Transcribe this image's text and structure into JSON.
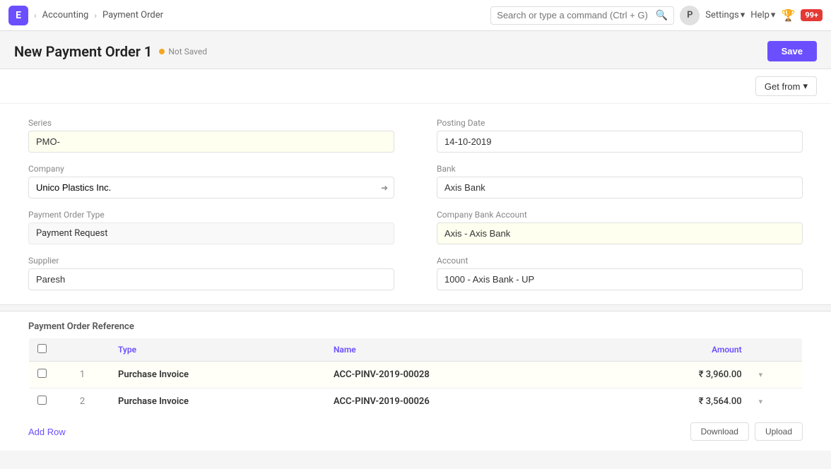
{
  "app": {
    "logo_letter": "E",
    "breadcrumb_1": "Accounting",
    "breadcrumb_2": "Payment Order",
    "search_placeholder": "Search or type a command (Ctrl + G)",
    "avatar_letter": "P",
    "settings_label": "Settings",
    "help_label": "Help",
    "badge_count": "99+"
  },
  "page": {
    "title": "New Payment Order 1",
    "status": "Not Saved",
    "save_label": "Save"
  },
  "get_from_label": "Get from",
  "form": {
    "series_label": "Series",
    "series_value": "PMO-",
    "posting_date_label": "Posting Date",
    "posting_date_value": "14-10-2019",
    "company_label": "Company",
    "company_value": "Unico Plastics Inc.",
    "bank_label": "Bank",
    "bank_value": "Axis Bank",
    "payment_order_type_label": "Payment Order Type",
    "payment_order_type_value": "Payment Request",
    "company_bank_account_label": "Company Bank Account",
    "company_bank_account_value": "Axis - Axis Bank",
    "supplier_label": "Supplier",
    "supplier_value": "Paresh",
    "account_label": "Account",
    "account_value": "1000 - Axis Bank - UP"
  },
  "table": {
    "section_title": "Payment Order Reference",
    "columns": {
      "type": "Type",
      "name": "Name",
      "amount": "Amount"
    },
    "rows": [
      {
        "num": "1",
        "type": "Purchase Invoice",
        "name": "ACC-PINV-2019-00028",
        "amount": "₹ 3,960.00"
      },
      {
        "num": "2",
        "type": "Purchase Invoice",
        "name": "ACC-PINV-2019-00026",
        "amount": "₹ 3,564.00"
      }
    ],
    "add_row_label": "Add Row",
    "download_label": "Download",
    "upload_label": "Upload"
  }
}
